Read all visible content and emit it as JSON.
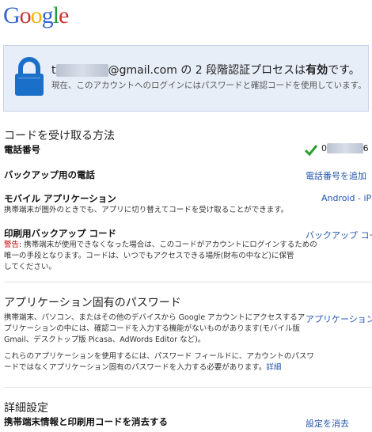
{
  "header": {
    "logo_text": "Google"
  },
  "status": {
    "email_prefix": "t",
    "email_hidden": "oxxxxxxx",
    "email_domain": "@gmail.com",
    "middle_text": "の 2 段階認証プロセスは",
    "state_text": "有効",
    "suffix": "です。",
    "sub_text": "現在、このアカウントへのログインにはパスワードと確認コードを使用しています。"
  },
  "receive_codes": {
    "title": "コードを受け取る方法",
    "phone_label": "電話番号",
    "phone_prefix": "0",
    "phone_hidden": "xxxxxxx",
    "phone_suffix": "6",
    "backup_phone_label": "バックアップ用の電話",
    "backup_phone_link": "電話番号を追加",
    "mobile_app_label": "モバイル アプリケーション",
    "mobile_app_desc": "携帯端末が圏外のときでも、アプリに切り替えてコードを受け取ることができます。",
    "mobile_app_link": "Android - iPh",
    "printed_label": "印刷用バックアップ コード",
    "printed_warn": "警告",
    "printed_desc_1": ": 携帯端末が使用できなくなった場合は、このコードがアカウントにログインするための",
    "printed_desc_2": "唯一の手段となります。コードは、いつでもアクセスできる場所(財布の中など)に保管",
    "printed_desc_3": "してください。",
    "printed_link": "バックアップ コー"
  },
  "app_passwords": {
    "title": "アプリケーション固有のパスワード",
    "desc_1": "携帯端末、パソコン、またはその他のデバイスから Google アカウントにアクセスするア",
    "desc_2": "プリケーションの中には、確認コードを入力する機能がないものがあります(モバイル版",
    "desc_3": "Gmail、デスクトップ版 Picasa、AdWords Editor など)。",
    "desc_4": "これらのアプリケーションを使用するには、パスワード フィールドに、アカウントのパスワ",
    "desc_5": "ードではなくアプリケーション固有のパスワードを入力する必要があります。",
    "detail_link": "詳細",
    "link": "アプリケーション[固"
  },
  "advanced": {
    "title": "詳細設定",
    "clear_label": "携帯端末情報と印刷用コードを消去する",
    "clear_link": "設定を消去"
  },
  "colors": {
    "accent_blue": "#2255aa",
    "lock_blue": "#1a6fc9",
    "check_green": "#2a9d2a",
    "warning_red": "#cc0000",
    "status_bg": "#e8eef8"
  }
}
